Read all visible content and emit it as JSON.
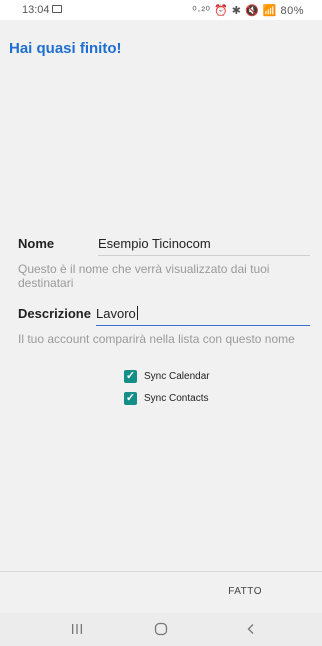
{
  "status_bar": {
    "time": "13:04",
    "right": "⁰·²⁰ ⏰ ✱ 🔇 📶 80%"
  },
  "header": {
    "title": "Hai quasi finito!"
  },
  "form": {
    "name_label": "Nome",
    "name_value": "Esempio Ticinocom",
    "name_helper": "Questo è il nome che verrà visualizzato dai tuoi destinatari",
    "description_label": "Descrizione",
    "description_value": "Lavoro",
    "description_helper": "Il tuo account comparirà nella lista con questo nome",
    "sync_calendar_label": "Sync Calendar",
    "sync_calendar_checked": true,
    "sync_contacts_label": "Sync Contacts",
    "sync_contacts_checked": true
  },
  "actions": {
    "done_label": "FATTO"
  },
  "nav": {
    "recents_icon": "recent-apps-icon",
    "home_icon": "home-icon",
    "back_icon": "back-icon"
  },
  "colors": {
    "accent": "#1f6fd1",
    "checkbox": "#138f87",
    "active_underline": "#3b6fd6"
  }
}
